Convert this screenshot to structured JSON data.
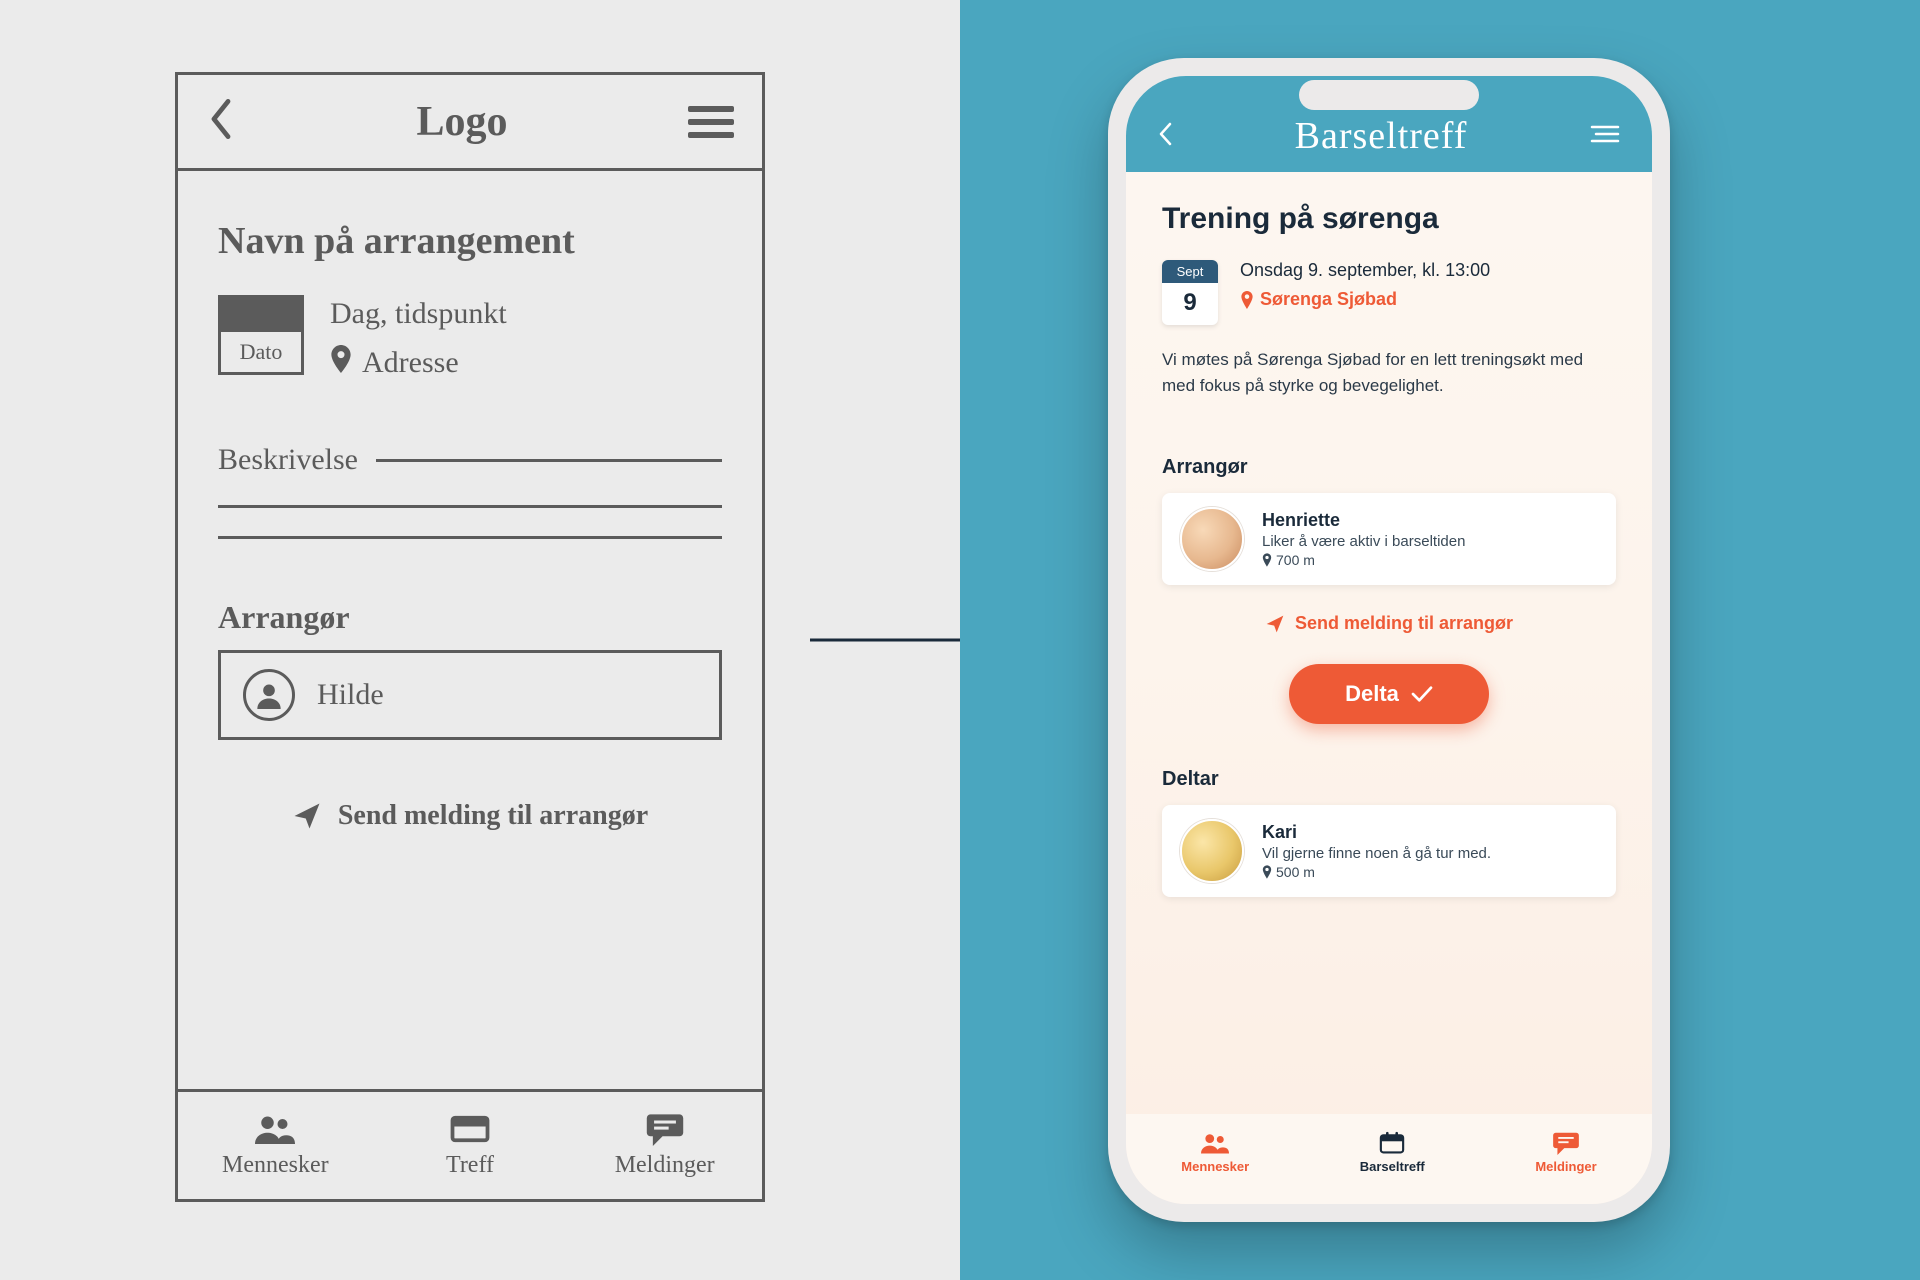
{
  "wireframe": {
    "logo": "Logo",
    "title": "Navn på arrangement",
    "cal_label": "Dato",
    "daytime": "Dag, tidspunkt",
    "address": "Adresse",
    "desc_label": "Beskrivelse",
    "organizer_label": "Arrangør",
    "organizer_name": "Hilde",
    "send_msg": "Send melding til arrangør",
    "tabs": {
      "people": "Mennesker",
      "meet": "Treff",
      "messages": "Meldinger"
    }
  },
  "app": {
    "brand": "Barseltreff",
    "event": {
      "title": "Trening på sørenga",
      "month": "Sept",
      "day": "9",
      "when": "Onsdag 9. september, kl. 13:00",
      "where": "Sørenga Sjøbad",
      "description": "Vi møtes på Sørenga Sjøbad for en lett treningsøkt med med fokus på styrke og bevegelighet."
    },
    "organizer": {
      "label": "Arrangør",
      "name": "Henriette",
      "bio": "Liker å være aktiv i barseltiden",
      "distance": "700 m"
    },
    "send_msg": "Send melding til arrangør",
    "cta": "Delta",
    "participants": {
      "label": "Deltar",
      "first": {
        "name": "Kari",
        "bio": "Vil gjerne finne noen å gå tur med.",
        "distance": "500 m"
      }
    },
    "tabs": {
      "people": "Mennesker",
      "meet": "Barseltreff",
      "messages": "Meldinger"
    },
    "accent": "#ee5a36",
    "teal": "#4aa6bf"
  }
}
